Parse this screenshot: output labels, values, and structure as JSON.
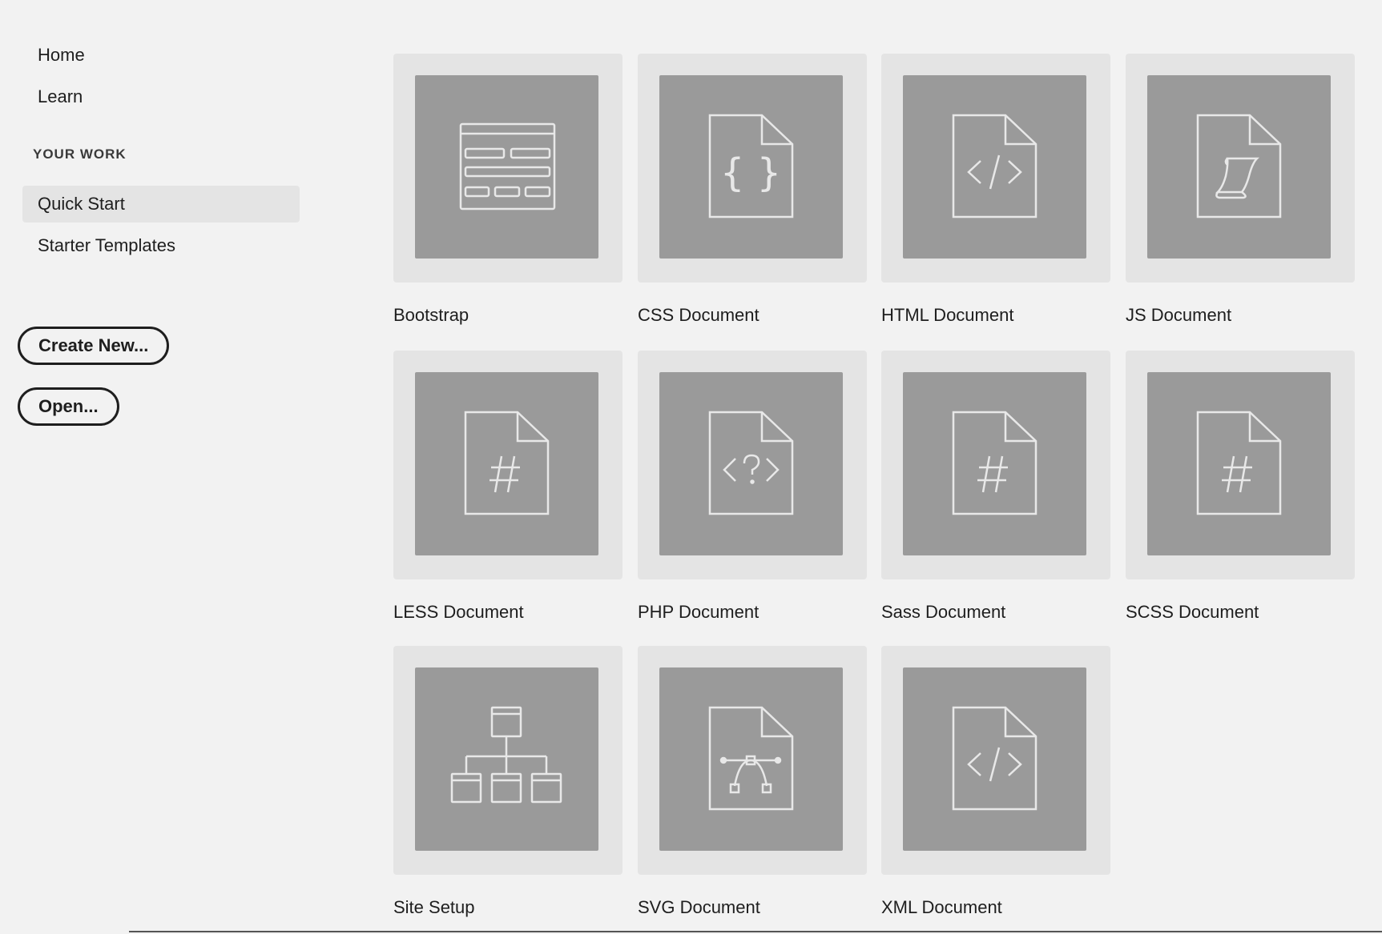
{
  "sidebar": {
    "nav": [
      {
        "label": "Home"
      },
      {
        "label": "Learn"
      }
    ],
    "section_heading": "YOUR WORK",
    "work_items": [
      {
        "label": "Quick Start",
        "selected": true
      },
      {
        "label": "Starter Templates",
        "selected": false
      }
    ],
    "create_button": "Create New...",
    "open_button": "Open..."
  },
  "tiles": [
    {
      "label": "Bootstrap",
      "icon": "bootstrap-layout-icon"
    },
    {
      "label": "CSS Document",
      "icon": "css-file-icon"
    },
    {
      "label": "HTML Document",
      "icon": "html-file-icon"
    },
    {
      "label": "JS Document",
      "icon": "js-file-icon"
    },
    {
      "label": "LESS Document",
      "icon": "less-file-icon"
    },
    {
      "label": "PHP Document",
      "icon": "php-file-icon"
    },
    {
      "label": "Sass Document",
      "icon": "sass-file-icon"
    },
    {
      "label": "SCSS Document",
      "icon": "scss-file-icon"
    },
    {
      "label": "Site Setup",
      "icon": "site-setup-icon"
    },
    {
      "label": "SVG Document",
      "icon": "svg-file-icon"
    },
    {
      "label": "XML Document",
      "icon": "xml-file-icon"
    }
  ],
  "colors": {
    "background": "#f2f2f2",
    "tile_frame": "#e4e4e4",
    "tile_inner": "#9a9a9a",
    "icon_stroke": "#e8e8e8",
    "selected_bg": "#e4e4e4"
  }
}
